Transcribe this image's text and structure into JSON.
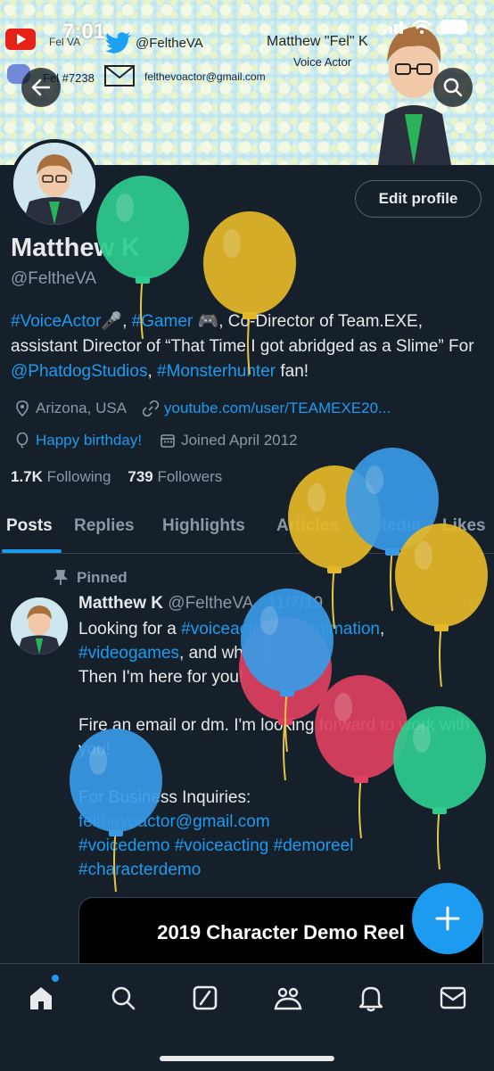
{
  "status_bar": {
    "time": "7:01"
  },
  "banner": {
    "youtube_label": "Fel VA",
    "twitter_handle": "@FeltheVA",
    "name": "Matthew \"Fel\" K",
    "role": "Voice Actor",
    "discord_label": "Fel #7238",
    "email": "felthevoactor@gmail.com"
  },
  "profile": {
    "edit_button": "Edit profile",
    "display_name": "Matthew K",
    "handle": "@FeltheVA",
    "bio": {
      "t1": "#VoiceActor",
      "t2": "🎤, ",
      "t3": "#Gamer",
      "t4": " 🎮, Co-Director of Team.EXE, assistant Director of “That Time I got abridged as a Slime” For ",
      "t5": "@PhatdogStudios",
      "t6": ", ",
      "t7": "#Monsterhunter",
      "t8": " fan!"
    },
    "location": "Arizona, USA",
    "website": "youtube.com/user/TEAMEXE20...",
    "birthday": "Happy birthday!",
    "joined": "Joined April 2012",
    "following_count": "1.7K",
    "following_label": "Following",
    "followers_count": "739",
    "followers_label": "Followers"
  },
  "tabs": [
    "Posts",
    "Replies",
    "Highlights",
    "Articles",
    "Media",
    "Likes"
  ],
  "tweet": {
    "pinned_label": "Pinned",
    "author": "Matthew K",
    "handle_date": "@FeltheVA · 11/7/19",
    "more": "···",
    "l1a": "Looking for a ",
    "l1b": "#voiceactor",
    "l1c": " for ",
    "l1d": "#animation",
    "l1e": ",",
    "l2a": "#videogames",
    "l2b": ", and what not?",
    "l3": "Then I'm here for you!",
    "l4": "Fire an email or dm. I'm looking forward to work with you!",
    "l5": "For Business Inquiries:",
    "l6": "felthevoactor@gmail.com",
    "l7a": "#voicedemo",
    "l7b": " #voiceacting",
    "l7c": "  #demoreel",
    "l8": "#characterdemo",
    "media_title": "2019 Character Demo Reel"
  },
  "fab": {
    "label": "+"
  },
  "nav": [
    "home-icon",
    "search-icon",
    "grok-icon",
    "communities-icon",
    "notifications-icon",
    "messages-icon"
  ],
  "balloons": [
    "#2ecc8f",
    "#e6b828",
    "#e6b828",
    "#3a9ae6",
    "#e6b828",
    "#e04062",
    "#3a9ae6",
    "#e04062",
    "#2ecc8f",
    "#3a9ae6"
  ],
  "colors": {
    "accent": "#1d9bf0",
    "background": "#15202b",
    "muted": "#8b98a5",
    "text": "#e7e9ea"
  }
}
